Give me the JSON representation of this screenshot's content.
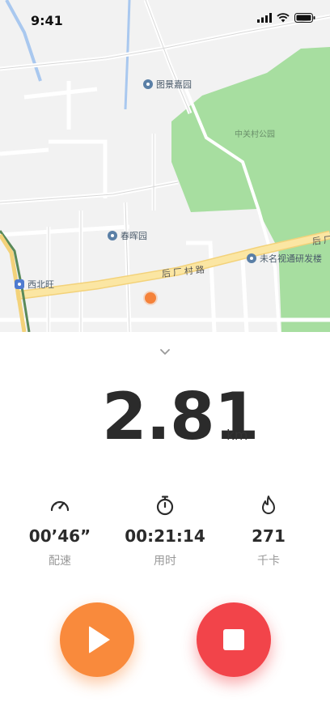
{
  "status_bar": {
    "time": "9:41",
    "icons": [
      "signal-icon",
      "wifi-icon",
      "battery-icon"
    ]
  },
  "map": {
    "pois": [
      {
        "label": "图景嘉园"
      },
      {
        "label": "春晖园"
      },
      {
        "label": "西北旺"
      },
      {
        "label": "未名视通研发楼"
      }
    ],
    "park_label": "中关村公园",
    "road_label": "后厂村路",
    "road_label_edge": "后厂",
    "colors": {
      "background": "#f2f2f2",
      "park": "#a7dea0",
      "road_major": "#fbe6a3",
      "water": "#a9c8ef",
      "location_dot": "#f5823a"
    }
  },
  "panel": {
    "collapse_icon": "chevron-down-icon",
    "distance": {
      "value": "2.81",
      "unit": "km"
    },
    "stats": [
      {
        "icon": "speedometer-icon",
        "value": "00’46”",
        "label": "配速"
      },
      {
        "icon": "stopwatch-icon",
        "value": "00:21:14",
        "label": "用时"
      },
      {
        "icon": "flame-icon",
        "value": "271",
        "label": "千卡"
      }
    ],
    "buttons": {
      "play": {
        "icon": "play-icon",
        "color": "#f98a3c"
      },
      "stop": {
        "icon": "stop-icon",
        "color": "#f2444a"
      }
    }
  }
}
